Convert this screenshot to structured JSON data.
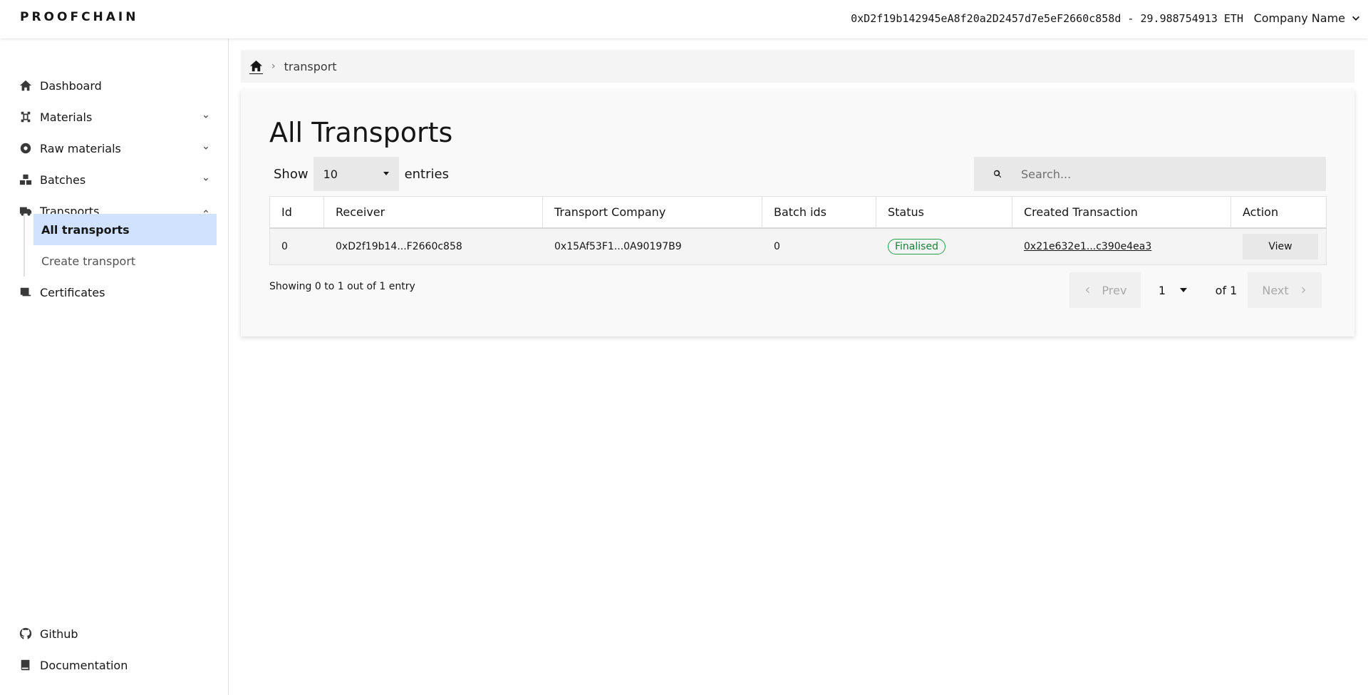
{
  "header": {
    "logo": "PROOFCHAIN",
    "wallet": "0xD2f19b142945eA8f20a2D2457d7e5eF2660c858d - 29.988754913 ETH",
    "company": "Company Name"
  },
  "sidebar": {
    "items": [
      {
        "label": "Dashboard",
        "icon": "home-icon"
      },
      {
        "label": "Materials",
        "icon": "materials-icon"
      },
      {
        "label": "Raw materials",
        "icon": "raw-materials-icon"
      },
      {
        "label": "Batches",
        "icon": "batches-icon"
      },
      {
        "label": "Transports",
        "icon": "truck-icon"
      },
      {
        "label": "Certificates",
        "icon": "certificate-icon"
      }
    ],
    "sub_items": [
      {
        "label": "All transports",
        "active": true
      },
      {
        "label": "Create transport",
        "active": false
      }
    ],
    "bottom": [
      {
        "label": "Github",
        "icon": "github-icon"
      },
      {
        "label": "Documentation",
        "icon": "book-icon"
      }
    ]
  },
  "breadcrumb": {
    "current": "transport"
  },
  "main": {
    "title": "All Transports",
    "show_label": "Show",
    "entries_value": "10",
    "entries_label": "entries",
    "search_placeholder": "Search...",
    "columns": [
      "Id",
      "Receiver",
      "Transport Company",
      "Batch ids",
      "Status",
      "Created Transaction",
      "Action"
    ],
    "rows": [
      {
        "id": "0",
        "receiver": "0xD2f19b14...F2660c858",
        "company": "0x15Af53F1...0A90197B9",
        "batch_ids": "0",
        "status": "Finalised",
        "transaction": "0x21e632e1...c390e4ea3",
        "action": "View"
      }
    ],
    "summary": "Showing 0 to 1 out of 1 entry",
    "pager": {
      "prev": "Prev",
      "page": "1",
      "of": "of 1",
      "next": "Next"
    }
  },
  "colors": {
    "accent": "#d0e2ff",
    "status_green": "#24a148"
  }
}
